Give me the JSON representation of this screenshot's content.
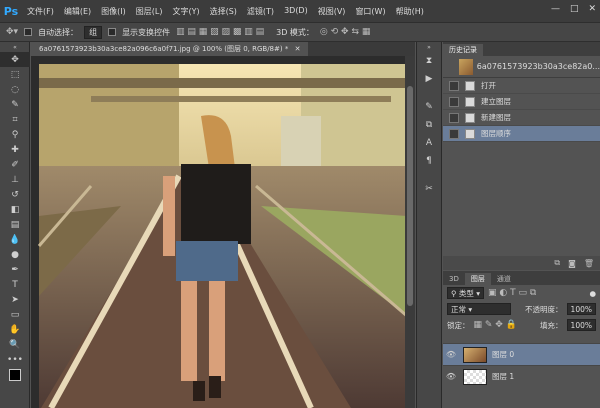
{
  "app": {
    "logo": "Ps"
  },
  "menus": [
    "文件(F)",
    "编辑(E)",
    "图像(I)",
    "图层(L)",
    "文字(Y)",
    "选择(S)",
    "滤镜(T)",
    "3D(D)",
    "视图(V)",
    "窗口(W)",
    "帮助(H)"
  ],
  "window_controls": {
    "min": "—",
    "max": "□",
    "close": "✕"
  },
  "options": {
    "auto_select_label": "自动选择：",
    "auto_select_value": "组",
    "show_transform_label": "显示变换控件",
    "mode_3d_label": "3D 模式："
  },
  "document": {
    "tab_title": "6a0761573923b30a3ce82a096c6a0f71.jpg @ 100% (图层 0, RGB/8#) *",
    "close": "✕"
  },
  "history": {
    "tab": "历史记录",
    "snapshot": "6a0761573923b30a3ce82a0...",
    "items": [
      "打开",
      "建立图层",
      "新建图层",
      "图层顺序"
    ],
    "selected_index": 3
  },
  "layers": {
    "tabs": [
      "3D",
      "图层",
      "通道"
    ],
    "filter_label": "类型",
    "blend_mode": "正常",
    "opacity_label": "不透明度：",
    "opacity": "100%",
    "lock_label": "锁定：",
    "fill_label": "填充：",
    "fill": "100%",
    "items": [
      {
        "name": "图层 0",
        "selected": true
      },
      {
        "name": "图层 1",
        "selected": false
      }
    ]
  },
  "colors": {
    "ui_dark": "#535353",
    "selection": "#6a7d99",
    "ps_blue": "#32aaff"
  }
}
